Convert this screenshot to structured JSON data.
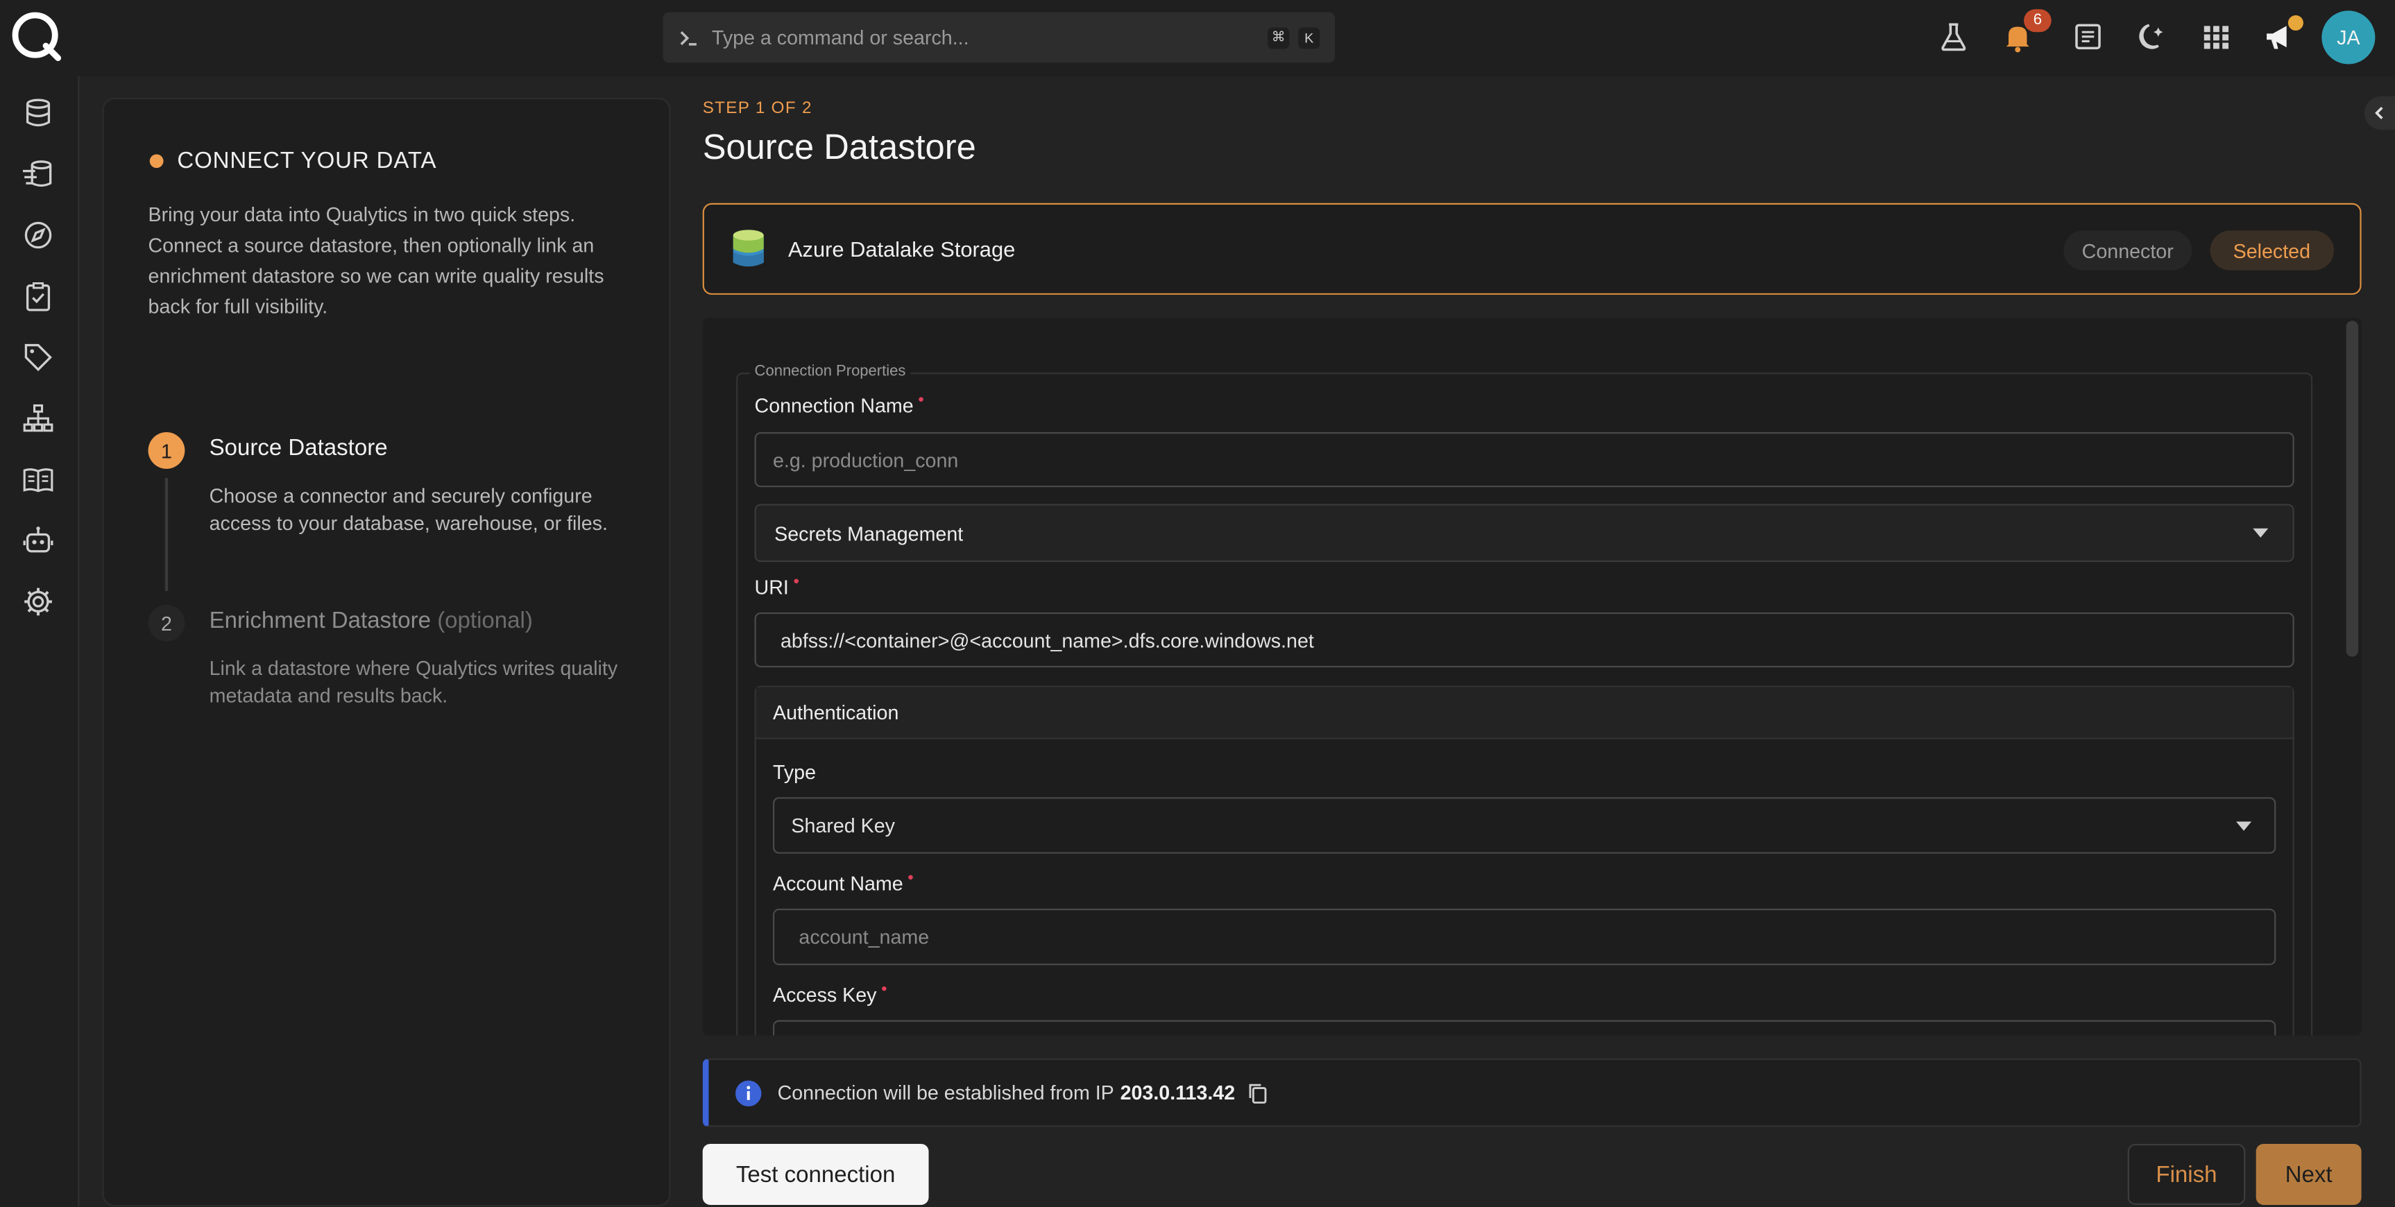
{
  "topbar": {
    "search_placeholder": "Type a command or search...",
    "shortcut_keys": [
      "⌘",
      "K"
    ],
    "notification_count": "6",
    "user_initials": "JA",
    "icons": [
      "flask-icon",
      "bell-icon",
      "document-icon",
      "moon-icon",
      "grid-icon",
      "megaphone-icon"
    ]
  },
  "sidebar": {
    "icons": [
      "database-icon",
      "flow-icon",
      "compass-icon",
      "checklist-icon",
      "tag-icon",
      "hierarchy-icon",
      "book-icon",
      "robot-icon",
      "gear-icon"
    ]
  },
  "left_panel": {
    "heading": "CONNECT YOUR DATA",
    "description": "Bring your data into Qualytics in two quick steps. Connect a source datastore, then optionally link an enrichment datastore so we can write quality results back for full visibility.",
    "steps": [
      {
        "number": "1",
        "title": "Source Datastore",
        "suffix": "",
        "description": "Choose a connector and securely configure access to your database, warehouse, or files."
      },
      {
        "number": "2",
        "title": "Enrichment Datastore",
        "suffix": "(optional)",
        "description": "Link a datastore where Qualytics writes quality metadata and results back."
      }
    ]
  },
  "main": {
    "step_label": "STEP 1 OF 2",
    "title": "Source Datastore",
    "connector": {
      "name": "Azure Datalake Storage",
      "chip_connector": "Connector",
      "chip_selected": "Selected"
    },
    "form": {
      "legend": "Connection Properties",
      "connection_name": {
        "label": "Connection Name",
        "required": "•",
        "placeholder": "e.g. production_conn"
      },
      "secrets_management": {
        "label": "Secrets Management"
      },
      "uri": {
        "label": "URI",
        "required": "•",
        "value": "abfss://<container>@<account_name>.dfs.core.windows.net"
      },
      "authentication": {
        "title": "Authentication",
        "type_label": "Type",
        "type_value": "Shared Key",
        "account_name": {
          "label": "Account Name",
          "required": "•",
          "placeholder": "account_name"
        },
        "access_key": {
          "label": "Access Key",
          "required": "•"
        }
      }
    },
    "info": {
      "text": "Connection will be established from IP",
      "ip": "203.0.113.42"
    },
    "buttons": {
      "test": "Test connection",
      "finish": "Finish",
      "next": "Next"
    }
  },
  "colors": {
    "accent": "#ef9d4f",
    "info_bar": "#3d63d8",
    "required": "#e0405a",
    "avatar": "#2f9fb5"
  }
}
